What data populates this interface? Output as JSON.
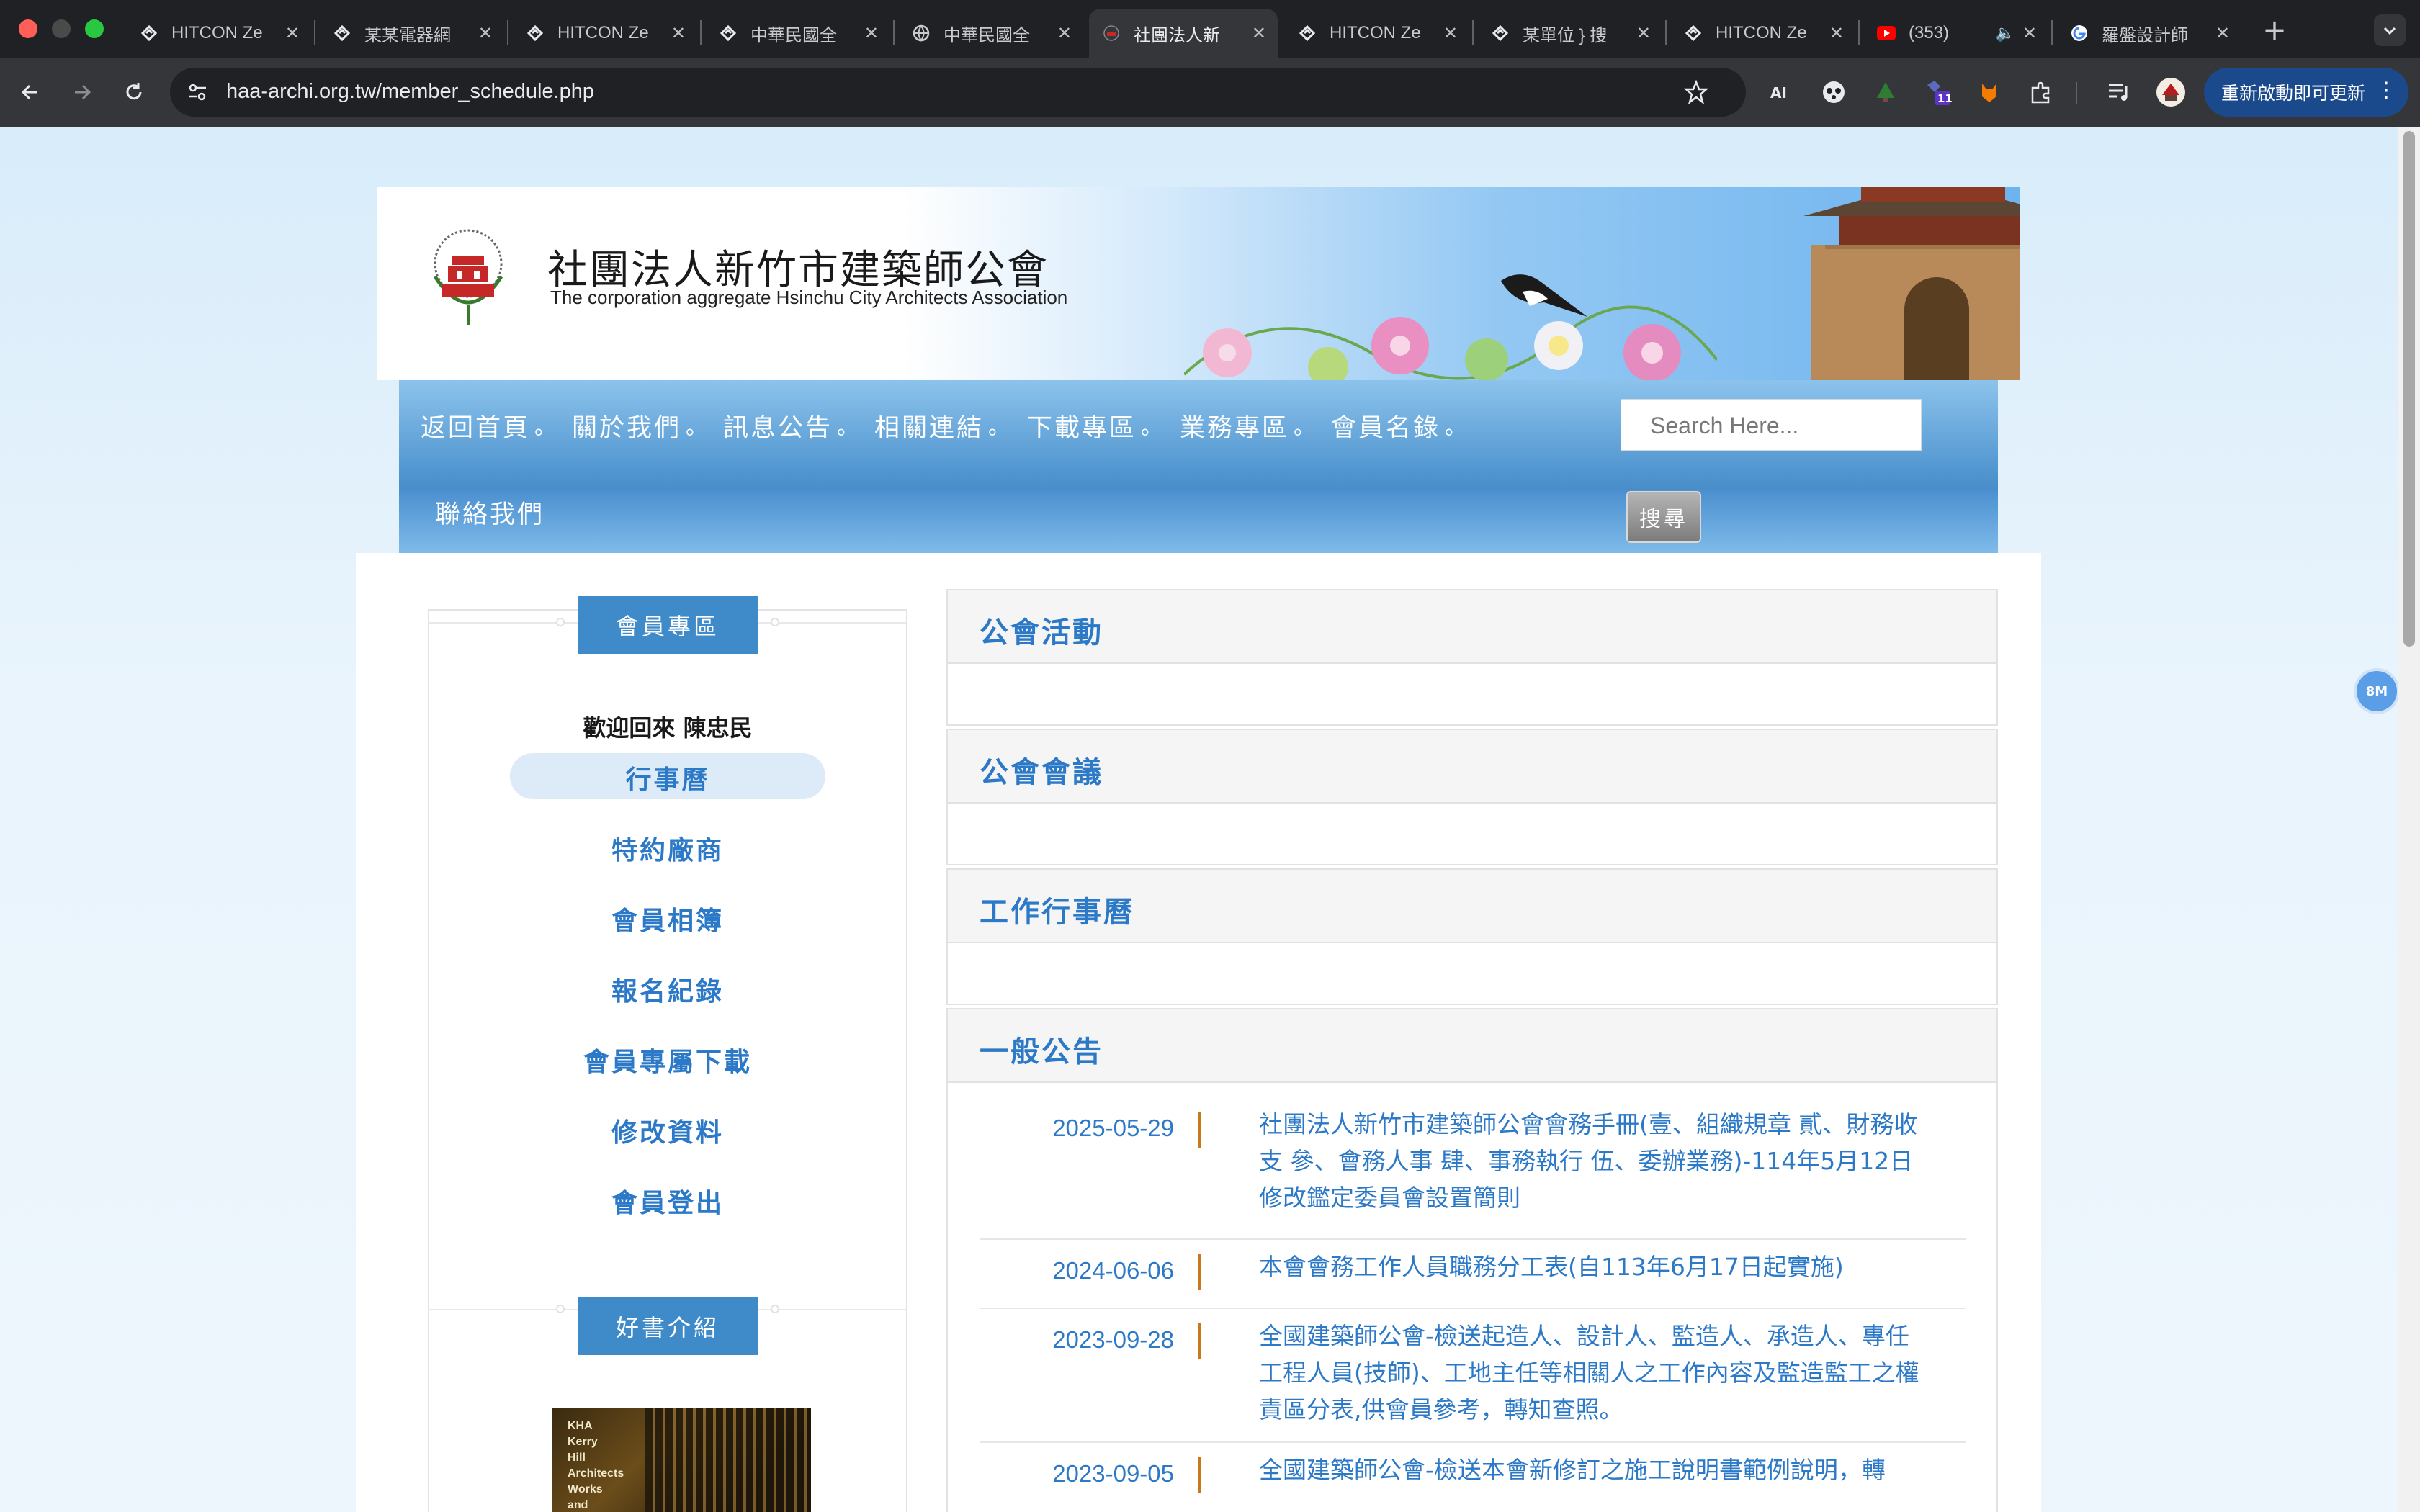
{
  "browser": {
    "tabs": [
      {
        "title": "HITCON Ze",
        "icon": "hitcon-icon",
        "active": false
      },
      {
        "title": "某某電器網",
        "icon": "hitcon-icon",
        "active": false
      },
      {
        "title": "HITCON Ze",
        "icon": "hitcon-icon",
        "active": false
      },
      {
        "title": "中華民國全",
        "icon": "hitcon-icon",
        "active": false
      },
      {
        "title": "中華民國全",
        "icon": "globe-icon",
        "active": false
      },
      {
        "title": "社團法人新",
        "icon": "site-icon",
        "active": true
      },
      {
        "title": "HITCON Ze",
        "icon": "hitcon-icon",
        "active": false
      },
      {
        "title": "某單位 } 搜",
        "icon": "hitcon-icon",
        "active": false
      },
      {
        "title": "HITCON Ze",
        "icon": "hitcon-icon",
        "active": false
      },
      {
        "title": "(353)",
        "icon": "youtube-icon",
        "active": false
      },
      {
        "title": "羅盤設計師",
        "icon": "google-icon",
        "active": false
      }
    ],
    "url": "haa-archi.org.tw/member_schedule.php",
    "update_button": "重新啟動即可更新",
    "extension_badge": "11"
  },
  "site": {
    "title": "社團法人新竹市建築師公會",
    "subtitle": "The corporation aggregate Hsinchu City Architects Association"
  },
  "nav": {
    "items": [
      "返回首頁",
      "關於我們",
      "訊息公告",
      "相關連結",
      "下載專區",
      "業務專區",
      "會員名錄",
      "聯絡我們"
    ],
    "separator": "。",
    "search_placeholder": "Search Here...",
    "search_button": "搜尋"
  },
  "sidebar": {
    "member_heading": "會員專區",
    "welcome": "歡迎回來 陳忠民",
    "items": [
      "行事曆",
      "特約廠商",
      "會員相簿",
      "報名紀錄",
      "會員專屬下載",
      "修改資料",
      "會員登出"
    ],
    "active_item": "行事曆",
    "book_heading": "好書介紹",
    "book_cover_text": [
      "KHA",
      "Kerry",
      "Hill",
      "Architects",
      "Works",
      "and"
    ]
  },
  "sections": [
    {
      "title": "公會活動",
      "entries": []
    },
    {
      "title": "公會會議",
      "entries": []
    },
    {
      "title": "工作行事曆",
      "entries": []
    },
    {
      "title": "一般公告",
      "entries": [
        {
          "date": "2025-05-29",
          "text": "社團法人新竹市建築師公會會務手冊(壹、組織規章 貳、財務收支 參、會務人事 肆、事務執行 伍、委辦業務)-114年5月12日修改鑑定委員會設置簡則"
        },
        {
          "date": "2024-06-06",
          "text": "本會會務工作人員職務分工表(自113年6月17日起實施)"
        },
        {
          "date": "2023-09-28",
          "text": "全國建築師公會-檢送起造人、設計人、監造人、承造人、專任工程人員(技師)、工地主任等相關人之工作內容及監造監工之權責區分表,供會員參考，轉知查照。"
        },
        {
          "date": "2023-09-05",
          "text": "全國建築師公會-檢送本會新修訂之施工說明書範例說明，轉"
        }
      ]
    }
  ],
  "floating_badge": "8M",
  "colors": {
    "accent": "#2c79c7",
    "heading_bg": "#3f8ac8",
    "date_bar": "#c8791c",
    "chrome_dark": "#202124"
  }
}
